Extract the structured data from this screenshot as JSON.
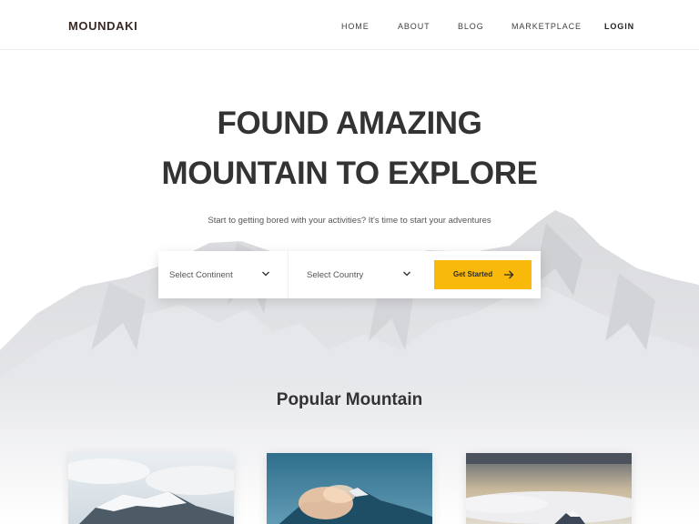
{
  "header": {
    "logo": "MOUNDAKI",
    "nav": [
      {
        "label": "HOME"
      },
      {
        "label": "ABOUT"
      },
      {
        "label": "BLOG"
      },
      {
        "label": "MARKETPLACE"
      },
      {
        "label": "LOGIN"
      }
    ]
  },
  "hero": {
    "title_line1": "FOUND AMAZING",
    "title_line2": "MOUNTAIN TO EXPLORE",
    "subtitle": "Start to getting bored with your activities? It's time to start your adventures"
  },
  "search": {
    "continent_placeholder": "Select Continent",
    "country_placeholder": "Select Country",
    "cta_label": "Get Started",
    "icons": {
      "dropdown": "chevron-down-icon",
      "cta": "arrow-right-icon"
    }
  },
  "popular": {
    "title": "Popular Mountain"
  },
  "colors": {
    "accent": "#f9b90a",
    "heading": "#333333",
    "logo": "#3a2a24"
  }
}
